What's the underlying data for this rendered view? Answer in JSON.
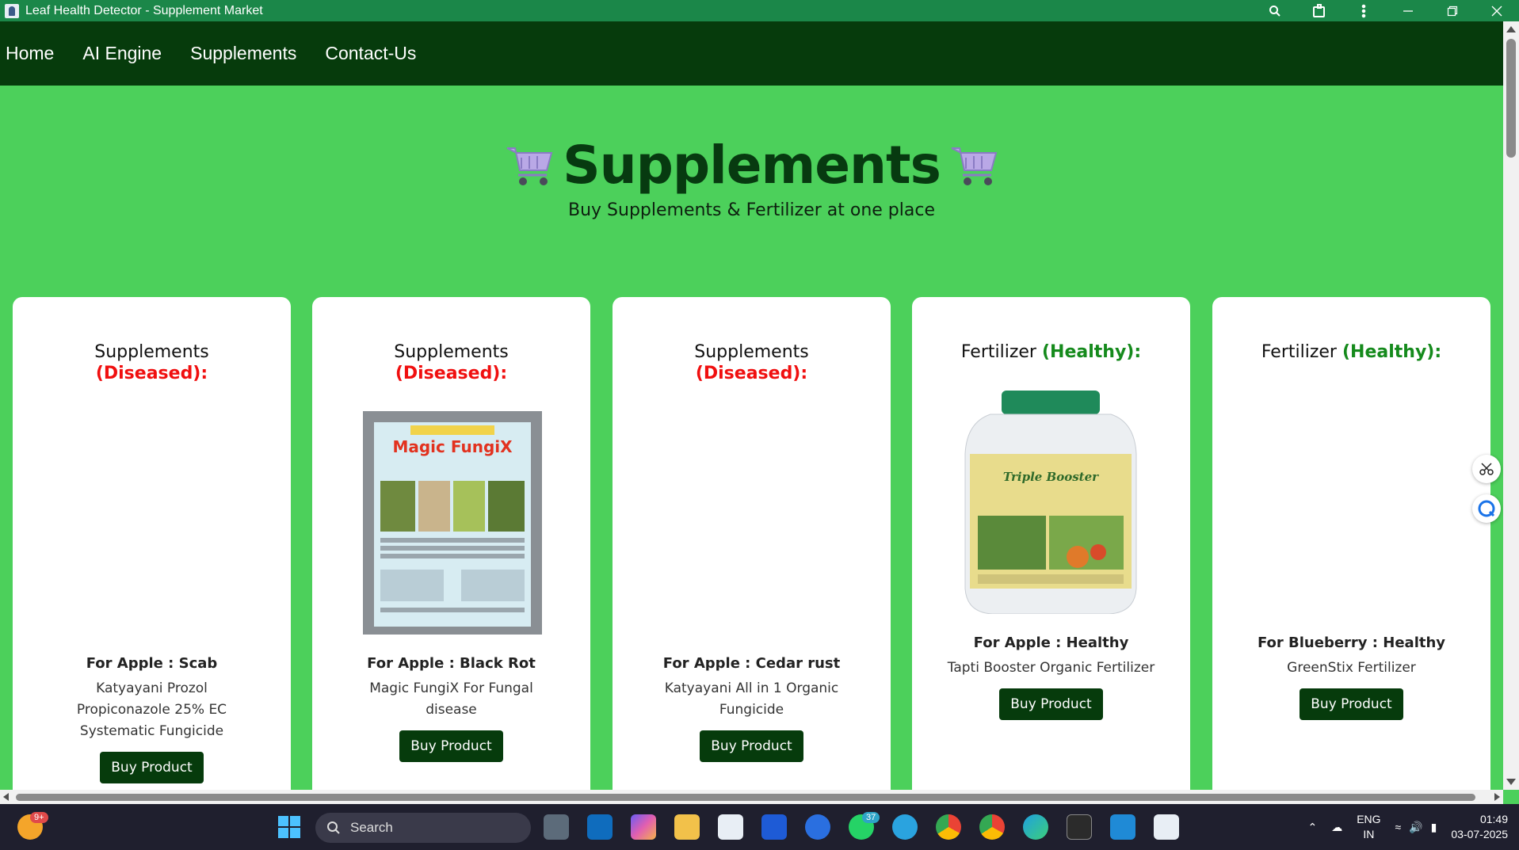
{
  "window": {
    "title": "Leaf Health Detector - Supplement Market",
    "controls": [
      "zoom-icon",
      "extensions-icon",
      "more-icon",
      "minimize-icon",
      "restore-icon",
      "close-icon"
    ]
  },
  "nav": {
    "items": [
      "Home",
      "AI Engine",
      "Supplements",
      "Contact-Us"
    ]
  },
  "hero": {
    "title": "Supplements",
    "subtitle": "Buy Supplements & Fertilizer at one place"
  },
  "cards": [
    {
      "heading": "Supplements",
      "tag": "(Diseased):",
      "for": "For Apple : Scab",
      "name": "Katyayani Prozol Propiconazole 25% EC Systematic Fungicide",
      "button": "Buy Product"
    },
    {
      "heading": "Supplements",
      "tag": "(Diseased):",
      "for": "For Apple : Black Rot",
      "name": "Magic FungiX For Fungal disease",
      "button": "Buy Product",
      "image_text": "Magic FungiX"
    },
    {
      "heading": "Supplements",
      "tag": "(Diseased):",
      "for": "For Apple : Cedar rust",
      "name": "Katyayani All in 1 Organic Fungicide",
      "button": "Buy Product"
    },
    {
      "heading": "Fertilizer",
      "tag": "(Healthy):",
      "for": "For Apple : Healthy",
      "name": "Tapti Booster Organic Fertilizer",
      "button": "Buy Product",
      "image_text": "Triple Booster"
    },
    {
      "heading": "Fertilizer",
      "tag": "(Healthy):",
      "for": "For Blueberry : Healthy",
      "name": "GreenStix Fertilizer",
      "button": "Buy Product"
    }
  ],
  "taskbar": {
    "search_placeholder": "Search",
    "weather_badge": "9+",
    "whatsapp_badge": "37",
    "lang_top": "ENG",
    "lang_bottom": "IN",
    "time": "01:49",
    "date": "03-07-2025"
  },
  "colors": {
    "page_bg": "#4cd05b",
    "nav_bg": "#063b0c",
    "titlebar_bg": "#1b8749",
    "diseased": "#f00f0f",
    "healthy": "#158a1c"
  }
}
